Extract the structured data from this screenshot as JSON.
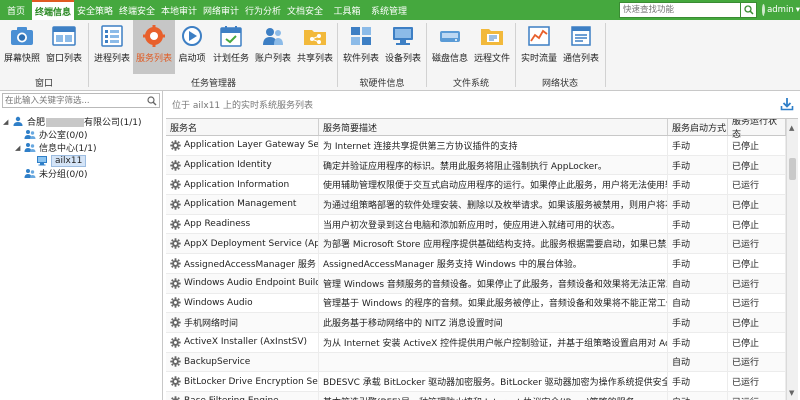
{
  "menu": {
    "tabs": [
      {
        "label": "首页",
        "active": false
      },
      {
        "label": "终端信息",
        "active": true
      },
      {
        "label": "安全策略",
        "active": false
      },
      {
        "label": "终端安全",
        "active": false
      },
      {
        "label": "本地审计",
        "active": false
      },
      {
        "label": "网络审计",
        "active": false
      },
      {
        "label": "行为分析",
        "active": false
      },
      {
        "label": "文档安全",
        "active": false
      },
      {
        "label": "工具箱",
        "active": false
      },
      {
        "label": "系统管理",
        "active": false
      }
    ],
    "search_placeholder": "快速查找功能",
    "user_name": "admin",
    "user_caret": "▾",
    "accent_color": "#45a83e",
    "active_tab_border": "#e05a22"
  },
  "ribbon": {
    "items": [
      {
        "label": "屏幕快照",
        "icon": "camera-icon",
        "selected": false
      },
      {
        "label": "窗口列表",
        "icon": "window-list-icon",
        "selected": false
      },
      {
        "label": "进程列表",
        "icon": "process-list-icon",
        "selected": false
      },
      {
        "label": "服务列表",
        "icon": "service-list-icon",
        "selected": true
      },
      {
        "label": "启动项",
        "icon": "startup-icon",
        "selected": false
      },
      {
        "label": "计划任务",
        "icon": "schedule-icon",
        "selected": false
      },
      {
        "label": "账户列表",
        "icon": "account-list-icon",
        "selected": false
      },
      {
        "label": "共享列表",
        "icon": "share-list-icon",
        "selected": false
      },
      {
        "label": "软件列表",
        "icon": "software-list-icon",
        "selected": false
      },
      {
        "label": "设备列表",
        "icon": "device-list-icon",
        "selected": false
      },
      {
        "label": "磁盘信息",
        "icon": "disk-info-icon",
        "selected": false
      },
      {
        "label": "远程文件",
        "icon": "remote-file-icon",
        "selected": false
      },
      {
        "label": "实时流量",
        "icon": "traffic-icon",
        "selected": false
      },
      {
        "label": "通信列表",
        "icon": "connection-list-icon",
        "selected": false
      }
    ],
    "groups": [
      "窗口",
      "任务管理器",
      "软硬件信息",
      "文件系统",
      "网络状态"
    ]
  },
  "tree": {
    "search_placeholder": "在此输入关键字筛选...",
    "nodes": [
      {
        "label": "合肥",
        "suffix": "有限公司(1/1)",
        "arrow": "◢",
        "icon": "org-icon"
      },
      {
        "label": "办公室(0/0)",
        "arrow": "",
        "icon": "group-icon"
      },
      {
        "label": "信息中心(1/1)",
        "arrow": "◢",
        "icon": "group-icon"
      },
      {
        "label": "ailx11",
        "arrow": "",
        "icon": "computer-icon",
        "selected": true
      },
      {
        "label": "未分组(0/0)",
        "arrow": "",
        "icon": "group-icon"
      }
    ]
  },
  "main": {
    "title": "位于 ailx11 上的实时系统服务列表",
    "columns": [
      "服务名",
      "服务简要描述",
      "服务启动方式",
      "服务运行状态"
    ],
    "rows": [
      {
        "name": "Application Layer Gateway Service",
        "desc": "为 Internet 连接共享提供第三方协议插件的支持",
        "start": "手动",
        "status": "已停止"
      },
      {
        "name": "Application Identity",
        "desc": "确定并验证应用程序的标识。禁用此服务将阻止强制执行 AppLocker。",
        "start": "手动",
        "status": "已停止"
      },
      {
        "name": "Application Information",
        "desc": "使用辅助管理权限便于交互式启动应用程序的运行。如果停止此服务，用户将无法使用辅助管理...",
        "start": "手动",
        "status": "已运行"
      },
      {
        "name": "Application Management",
        "desc": "为通过组策略部署的软件处理安装、删除以及枚举请求。如果该服务被禁用，则用户将不能...",
        "start": "手动",
        "status": "已停止"
      },
      {
        "name": "App Readiness",
        "desc": "当用户初次登录到这台电脑和添加新应用时，使应用进入就绪可用的状态。",
        "start": "手动",
        "status": "已停止"
      },
      {
        "name": "AppX Deployment Service (AppXSVC)",
        "desc": "为部署 Microsoft Store 应用程序提供基础结构支持。此服务根据需要启动，如果已禁用...",
        "start": "手动",
        "status": "已运行"
      },
      {
        "name": "AssignedAccessManager 服务",
        "desc": "AssignedAccessManager 服务支持 Windows 中的展台体验。",
        "start": "手动",
        "status": "已停止"
      },
      {
        "name": "Windows Audio Endpoint Builder",
        "desc": "管理 Windows 音频服务的音频设备。如果停止了此服务，音频设备和效果将无法正常工作...",
        "start": "自动",
        "status": "已运行"
      },
      {
        "name": "Windows Audio",
        "desc": "管理基于 Windows 的程序的音频。如果此服务被停止，音频设备和效果将不能正常工作...",
        "start": "自动",
        "status": "已运行"
      },
      {
        "name": "手机网络时间",
        "desc": "此服务基于移动网络中的 NITZ 消息设置时间",
        "start": "手动",
        "status": "已停止"
      },
      {
        "name": "ActiveX Installer (AxInstSV)",
        "desc": "为从 Internet 安装 ActiveX 控件提供用户帐户控制验证，并基于组策略设置启用对 ActiveX...",
        "start": "手动",
        "status": "已停止"
      },
      {
        "name": "BackupService",
        "desc": "",
        "start": "自动",
        "status": "已运行"
      },
      {
        "name": "BitLocker Drive Encryption Service",
        "desc": "BDESVC 承载 BitLocker 驱动器加密服务。BitLocker 驱动器加密为操作系统提供安全启动...",
        "start": "手动",
        "status": "已运行"
      },
      {
        "name": "Base Filtering Engine",
        "desc": "基本筛选引擎(BFE)是一种管理防火墙和 Internet 协议安全(IPsec)策略的服务...",
        "start": "自动",
        "status": "已运行"
      }
    ]
  }
}
